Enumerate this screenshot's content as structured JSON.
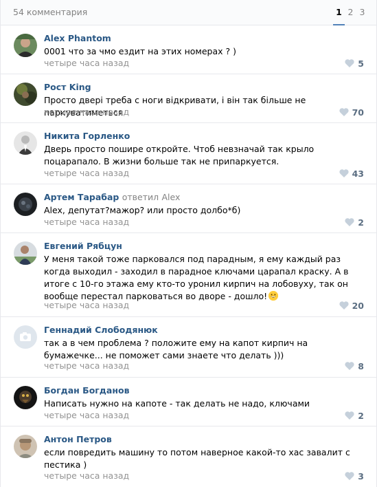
{
  "header": {
    "comments_count": "54 комментария",
    "pages": [
      "1",
      "2",
      "3"
    ]
  },
  "colors": {
    "link": "#2a5885",
    "muted": "#939393",
    "accent": "#5181b8",
    "like_icon": "#c5d0db"
  },
  "comments": [
    {
      "author": "Alex Phantom",
      "text": "0001 что за чмо ездит на этих номерах ? )",
      "time": "четыре часа назад",
      "likes": "5"
    },
    {
      "author": "Рост King",
      "text": "Просто двері треба с ноги відкривати, і він так більше не паркуватиметься",
      "time": "четыре часа назад",
      "likes": "70"
    },
    {
      "author": "Никита Горленко",
      "text": "Дверь просто пошире откройте. Чтоб невзначай так крыло поцарапало. В жизни больше так не припаркуется.",
      "time": "четыре часа назад",
      "likes": "43"
    },
    {
      "author": "Артем Тарабар",
      "reply_word": "ответил",
      "reply_to": "Alex",
      "text": "Alex, депутат?мажор? или просто долбо*б)",
      "time": "четыре часа назад",
      "likes": "2"
    },
    {
      "author": "Евгений Рябцун",
      "text": "У меня такой тоже парковался под парадным, я ему каждый раз когда выходил - заходил в парадное ключами царапал краску. А в итоге с 10-го этажа ему кто-то уронил кирпич на лобовуху, так он вообще перестал парковаться во дворе - дошло!",
      "emoji": "grinning-emoji",
      "time": "четыре часа назад",
      "likes": "20"
    },
    {
      "author": "Геннадий Слободянюк",
      "text": "так а в чем проблема ? положите ему на капот кирпич на бумажечке... не поможет сами знаете что делать )))",
      "time": "четыре часа назад",
      "likes": "8"
    },
    {
      "author": "Богдан Богданов",
      "text": "Написать нужно на капоте - так делать не надо, ключами",
      "time": "четыре часа назад",
      "likes": "2"
    },
    {
      "author": "Антон Петров",
      "text": "если повредить машину то потом наверное какой-то хас завалит с пестика )",
      "time": "четыре часа назад",
      "likes": "3"
    }
  ]
}
